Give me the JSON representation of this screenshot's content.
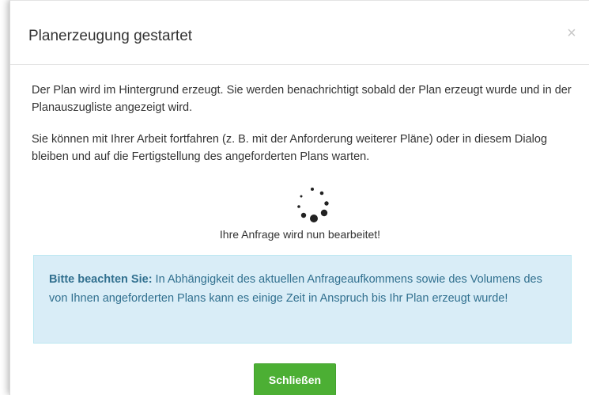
{
  "dialog": {
    "title": "Planerzeugung gestartet",
    "close_glyph": "×",
    "paragraph_1": "Der Plan wird im Hintergrund erzeugt. Sie werden benachrichtigt sobald der Plan erzeugt wurde und in der Planauszugliste angezeigt wird.",
    "paragraph_2": "Sie können mit Ihrer Arbeit fortfahren (z. B. mit der Anforderung weiterer Pläne) oder in diesem Dialog bleiben und auf die Fertigstellung des angeforderten Plans warten.",
    "status_text": "Ihre Anfrage wird nun bearbeitet!",
    "notice_label": "Bitte beachten Sie:",
    "notice_text": " In Abhängigkeit des aktuellen Anfrageaufkommens sowie des Volumens des von Ihnen angeforderten Plans kann es einige Zeit in Anspruch bis Ihr Plan erzeugt wurde!",
    "close_button_label": "Schließen"
  },
  "colors": {
    "primary_button": "#4caf34",
    "notice_background": "#d9edf7",
    "notice_text": "#31708f",
    "body_text": "#333333"
  },
  "icons": {
    "spinner": "loading-spinner-icon",
    "close": "close-icon"
  }
}
